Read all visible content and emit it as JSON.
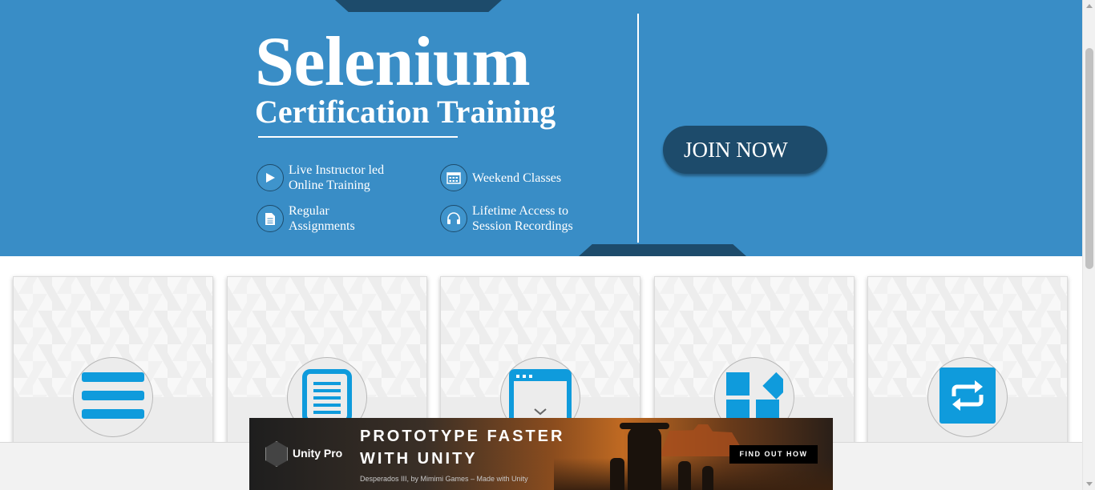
{
  "hero": {
    "title": "Selenium",
    "subtitle": "Certification Training",
    "features": [
      {
        "icon": "play-icon",
        "text": "Live Instructor led\nOnline Training"
      },
      {
        "icon": "calendar-icon",
        "text": "Weekend Classes"
      },
      {
        "icon": "document-icon",
        "text": "Regular\nAssignments"
      },
      {
        "icon": "headphones-icon",
        "text": "Lifetime Access to\nSession Recordings"
      }
    ],
    "cta_label": "JOIN NOW"
  },
  "cards": [
    {
      "icon": "menu-bars-icon"
    },
    {
      "icon": "document-lines-icon"
    },
    {
      "icon": "browser-window-icon"
    },
    {
      "icon": "blocks-icon"
    },
    {
      "icon": "repeat-icon"
    }
  ],
  "ad": {
    "logo_text": "Unity Pro",
    "headline_line1": "PROTOTYPE FASTER",
    "headline_line2": "WITH UNITY",
    "credit": "Desperados III, by Mimimi Games – Made with Unity",
    "cta": "FIND OUT HOW"
  },
  "colors": {
    "hero_bg": "#398dc6",
    "dark_accent": "#1d4b6b",
    "icon_blue": "#0f9bdc"
  }
}
